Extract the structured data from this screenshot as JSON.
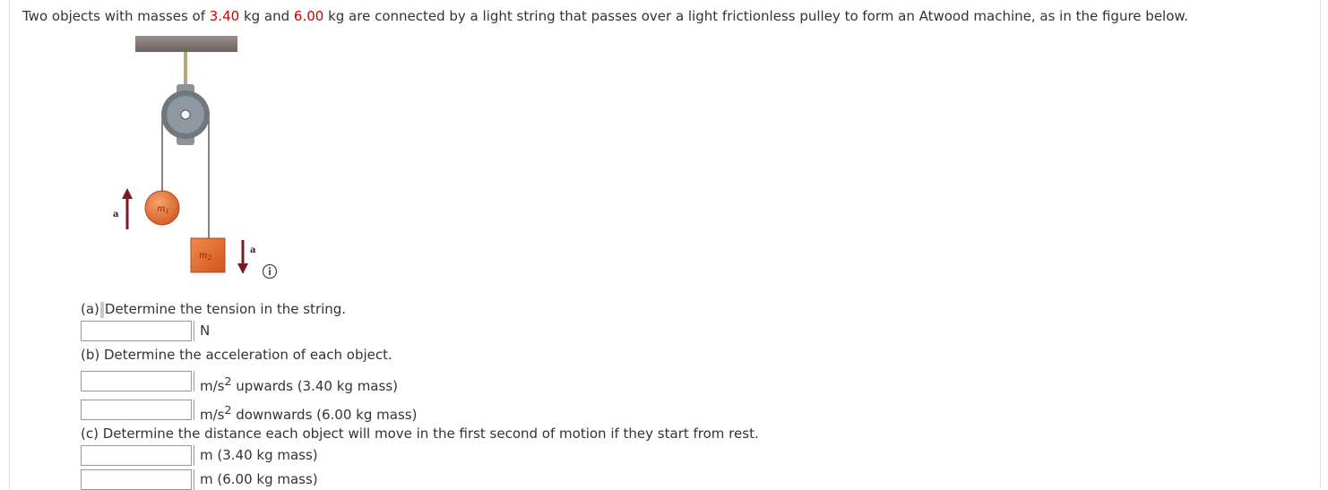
{
  "problem": {
    "intro_before_m1": "Two objects with masses of ",
    "m1": "3.40",
    "intro_mid": " kg and ",
    "m2": "6.00",
    "intro_after_m2": " kg are connected by a light string that passes over a light frictionless pulley to form an Atwood machine, as in the figure below."
  },
  "figure": {
    "m1_label": "m",
    "m1_sub": "1",
    "m2_label": "m",
    "m2_sub": "2",
    "accel_label_left": "a",
    "accel_label_right": "a"
  },
  "info_icon": "info-icon",
  "part_a": {
    "prefix": "(a)",
    "question": "Determine the tension in the string.",
    "unit": "N",
    "value": ""
  },
  "part_b": {
    "question": "(b) Determine the acceleration of each object.",
    "unit1_base": "m/s",
    "unit1_exp": "2",
    "unit1_suffix": " upwards (3.40 kg mass)",
    "unit2_base": "m/s",
    "unit2_exp": "2",
    "unit2_suffix": " downwards (6.00 kg mass)",
    "value1": "",
    "value2": ""
  },
  "part_c": {
    "question": "(c) Determine the distance each object will move in the first second of motion if they start from rest.",
    "unit1": "m (3.40 kg mass)",
    "unit2": "m (6.00 kg mass)",
    "value1": "",
    "value2": ""
  }
}
